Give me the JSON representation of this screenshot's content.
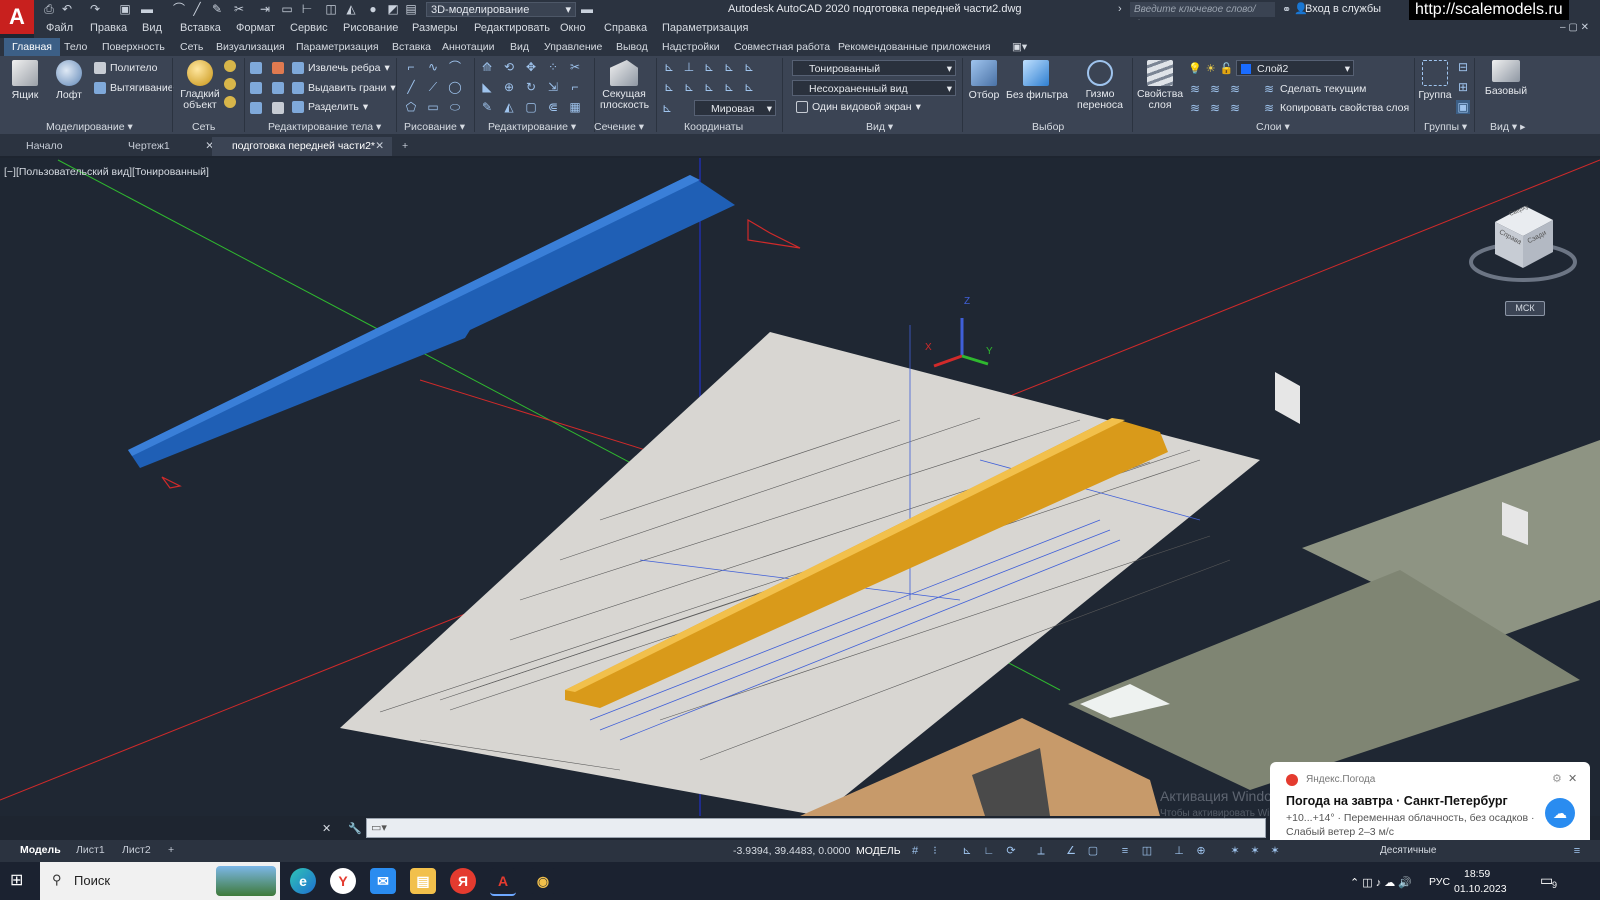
{
  "title_bar": {
    "app_title": "Autodesk AutoCAD 2020   подготовка передней части2.dwg",
    "workspace": "3D-моделирование",
    "search_placeholder": "Введите ключевое слово/фразу",
    "login": "Вход в службы",
    "watermark_url": "http://scalemodels.ru"
  },
  "menu": [
    "Файл",
    "Правка",
    "Вид",
    "Вставка",
    "Формат",
    "Сервис",
    "Рисование",
    "Размеры",
    "Редактировать",
    "Окно",
    "Справка",
    "Параметризация"
  ],
  "ribbon_tabs": [
    "Главная",
    "Тело",
    "Поверхность",
    "Сеть",
    "Визуализация",
    "Параметризация",
    "Вставка",
    "Аннотации",
    "Вид",
    "Управление",
    "Вывод",
    "Надстройки",
    "Совместная работа",
    "Рекомендованные приложения"
  ],
  "ribbon": {
    "modeling": {
      "title": "Моделирование",
      "box": "Ящик",
      "loft": "Лофт",
      "polysolid": "Политело",
      "extrude": "Вытягивание"
    },
    "mesh": {
      "title": "Сеть",
      "smooth": "Гладкий\nобъект"
    },
    "solid_edit": {
      "title": "Редактирование тела",
      "extract_edges": "Извлечь ребра",
      "extrude_faces": "Выдавить грани",
      "separate": "Разделить"
    },
    "draw": {
      "title": "Рисование"
    },
    "modify": {
      "title": "Редактирование"
    },
    "section": {
      "title": "Сечение",
      "section_plane": "Секущая\nплоскость"
    },
    "coordinates": {
      "title": "Координаты",
      "world": "Мировая"
    },
    "view": {
      "title": "Вид",
      "visual_style": "Тонированный",
      "saved_view": "Несохраненный вид",
      "viewports": "Один видовой экран"
    },
    "selection": {
      "title": "Выбор",
      "cull": "Отбор",
      "no_filter": "Без фильтра",
      "gizmo": "Гизмо\nпереноса"
    },
    "layers": {
      "title": "Слои",
      "layer_props": "Свойства\nслоя",
      "current_layer": "Слой2",
      "make_current": "Сделать текущим",
      "match_layer": "Копировать свойства слоя"
    },
    "groups": {
      "title": "Группы",
      "group": "Группа"
    },
    "view2": {
      "title": "Вид",
      "base": "Базовый"
    }
  },
  "doc_tabs": [
    {
      "label": "Начало"
    },
    {
      "label": "Чертеж1"
    },
    {
      "label": "подготовка передней части2*"
    }
  ],
  "viewport": {
    "label": "[−][Пользовательский вид][Тонированный]",
    "viewcube_top": "Сверху",
    "viewcube_left": "Справа",
    "viewcube_right": "Сзади",
    "ucs_label": "МСК",
    "axis_x": "X",
    "axis_y": "Y",
    "axis_z": "Z"
  },
  "layout_tabs": [
    "Модель",
    "Лист1",
    "Лист2"
  ],
  "status": {
    "coords": "-3.9394, 39.4483, 0.0000",
    "mode": "МОДЕЛЬ",
    "units": "Десятичные"
  },
  "notification": {
    "source": "Яндекс.Погода",
    "title": "Погода на завтра · Санкт-Петербург",
    "body": "+10...+14° · Переменная облачность, без осадков · Слабый ветер 2–3 м/с"
  },
  "activation": {
    "title": "Активация Windows",
    "sub": "Чтобы активировать Windows, перейдите в раздел \"Параметры\"."
  },
  "taskbar": {
    "search": "Поиск",
    "lang": "РУС",
    "time": "18:59",
    "date": "01.10.2023",
    "notify_count": "9"
  },
  "colors": {
    "blue_part": "#1f5fb5",
    "orange_part": "#d99a1a",
    "ribbon_active": "#3c5f86",
    "autocad_red": "#c8201e"
  }
}
